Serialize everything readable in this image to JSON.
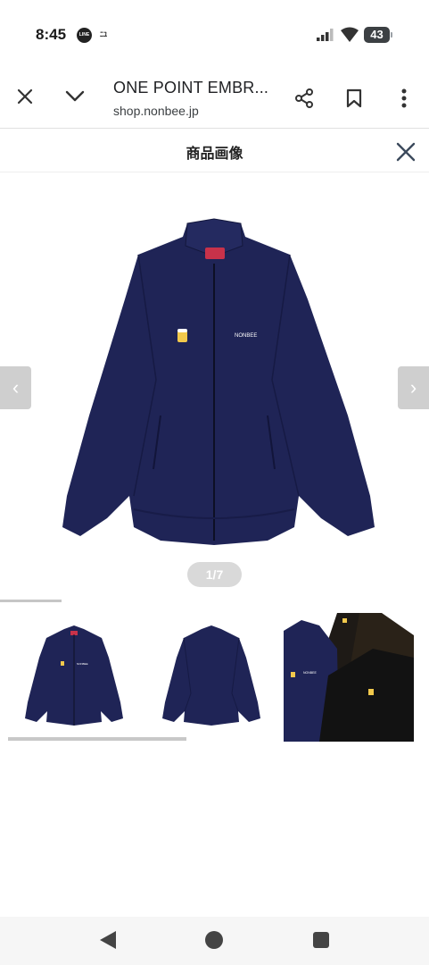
{
  "status_bar": {
    "time": "8:45",
    "line_label": "LINE",
    "mini_label": "ﾆﾕ",
    "battery": "43"
  },
  "browser": {
    "page_title": "ONE POINT EMBR...",
    "url": "shop.nonbee.jp",
    "icons": [
      "close-icon",
      "chevron-down-icon",
      "share-icon",
      "bookmark-icon",
      "more-vert-icon"
    ]
  },
  "sheet": {
    "title": "商品画像"
  },
  "gallery": {
    "pager": "1/7",
    "prev_glyph": "‹",
    "next_glyph": "›",
    "brand_text": "NONBEE",
    "label_text": "NONBEE",
    "jacket_color": "#1f2456",
    "thumbnails": [
      {
        "name": "front",
        "label": "NONBEE"
      },
      {
        "name": "back",
        "label": ""
      },
      {
        "name": "colors",
        "label": "NONBEE"
      }
    ]
  },
  "colors": {
    "navy": "#1f2456",
    "black": "#1a1a1a",
    "label_red": "#c8324a",
    "beer": "#f2c94c"
  }
}
